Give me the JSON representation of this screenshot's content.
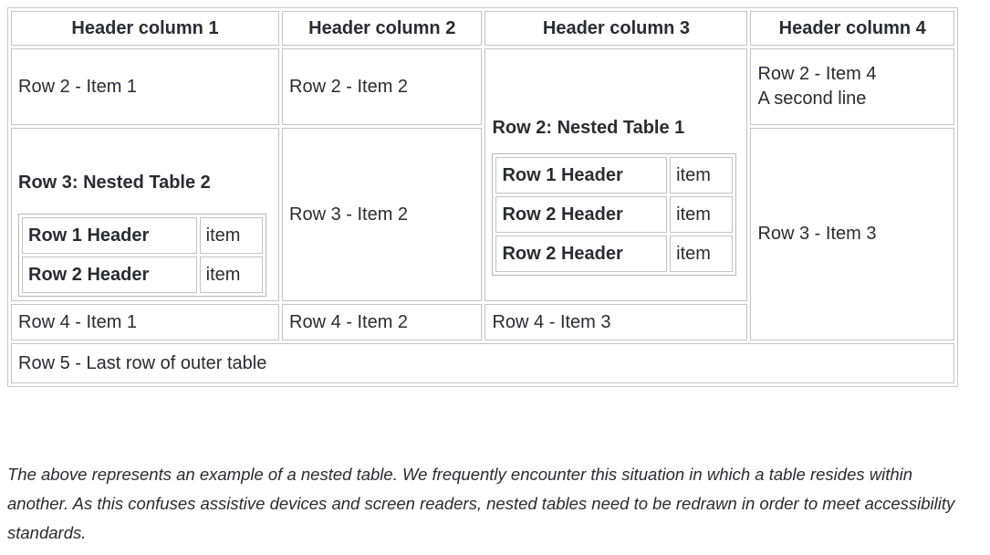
{
  "table": {
    "headers": [
      "Header column 1",
      "Header column 2",
      "Header column 3",
      "Header column 4"
    ],
    "row2": {
      "col1": "Row 2 - Item 1",
      "col2": "Row 2 - Item 2",
      "col3_title": "Row 2: Nested Table 1",
      "col4_line1": "Row 2 - Item 4",
      "col4_line2": "A second line"
    },
    "row3": {
      "col1_title": "Row 3: Nested Table 2",
      "col2": "Row 3 - Item 2",
      "col4": "Row 3 - Item 3"
    },
    "row4": {
      "col1": "Row 4 - Item 1",
      "col2": "Row 4 - Item 2",
      "col3": "Row 4 - Item 3"
    },
    "row5": {
      "col1": "Row 5 - Last row of outer table"
    },
    "nested_table_1": {
      "rows": [
        {
          "header": "Row 1 Header",
          "item": "item"
        },
        {
          "header": "Row 2 Header",
          "item": "item"
        },
        {
          "header": "Row 2 Header",
          "item": "item"
        }
      ]
    },
    "nested_table_2": {
      "rows": [
        {
          "header": "Row 1 Header",
          "item": "item"
        },
        {
          "header": "Row 2 Header",
          "item": "item"
        }
      ]
    }
  },
  "caption": {
    "text": "The above represents an example of a nested table. We frequently encounter this situation in which a table resides within another. As this confuses assistive devices and screen readers, nested tables need to be redrawn in order to meet accessibility standards."
  },
  "colors": {
    "text": "#2b2b33",
    "border": "#c4c4c4",
    "outer_border": "#c9c9c9",
    "background": "#ffffff"
  }
}
